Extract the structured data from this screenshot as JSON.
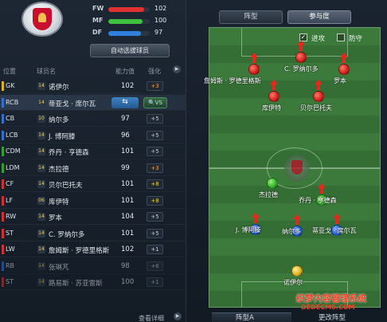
{
  "team": {
    "crest": "liverpool-crest-icon"
  },
  "stats": [
    {
      "label": "FW",
      "value": "102",
      "pct": 0.86,
      "color": "#e03030"
    },
    {
      "label": "MF",
      "value": "100",
      "pct": 0.82,
      "color": "#40c040"
    },
    {
      "label": "DF",
      "value": "97",
      "pct": 0.78,
      "color": "#3080e0"
    }
  ],
  "auto_button": "自动选拔球员",
  "table": {
    "headers": {
      "pos": "位置",
      "name": "球员名",
      "rating": "能力值",
      "strengthen": "强化"
    },
    "rows": [
      {
        "pos": "GK",
        "stripe": "#e0b020",
        "kit": "14",
        "name": "诺伊尔",
        "rating": "102",
        "chip": "+3",
        "chip_color": "#f0a040"
      },
      {
        "pos": "RCB",
        "stripe": "#3070d0",
        "kit": "14",
        "name": "蒂亚戈 · 席尔瓦",
        "rating": "",
        "chip": "",
        "chip_color": "#ffffff"
      },
      {
        "pos": "CB",
        "stripe": "#3070d0",
        "kit": "10",
        "name": "纳尔多",
        "rating": "97",
        "chip": "+5",
        "chip_color": "#c0c8d0"
      },
      {
        "pos": "LCB",
        "stripe": "#3070d0",
        "kit": "14",
        "name": "J. 博阿滕",
        "rating": "96",
        "chip": "+5",
        "chip_color": "#c0c8d0"
      },
      {
        "pos": "CDM",
        "stripe": "#30a030",
        "kit": "14",
        "name": "乔丹 · 亨德森",
        "rating": "101",
        "chip": "+5",
        "chip_color": "#c0c8d0"
      },
      {
        "pos": "LDM",
        "stripe": "#30a030",
        "kit": "14",
        "name": "杰拉德",
        "rating": "99",
        "chip": "+3",
        "chip_color": "#f0a040"
      },
      {
        "pos": "CF",
        "stripe": "#d03030",
        "kit": "14",
        "name": "贝尔巴托夫",
        "rating": "101",
        "chip": "+8",
        "chip_color": "#f0d040"
      },
      {
        "pos": "LF",
        "stripe": "#d03030",
        "kit": "06",
        "name": "库伊特",
        "rating": "101",
        "chip": "+8",
        "chip_color": "#f0d040"
      },
      {
        "pos": "RW",
        "stripe": "#d03030",
        "kit": "14",
        "name": "罗本",
        "rating": "104",
        "chip": "+5",
        "chip_color": "#c0c8d0"
      },
      {
        "pos": "ST",
        "stripe": "#d03030",
        "kit": "14",
        "name": "C. 罗纳尔多",
        "rating": "101",
        "chip": "+5",
        "chip_color": "#c0c8d0"
      },
      {
        "pos": "LW",
        "stripe": "#d03030",
        "kit": "14",
        "name": "詹姆斯 · 罗德里格斯",
        "rating": "102",
        "chip": "+1",
        "chip_color": "#c0c8d0"
      },
      {
        "pos": "RB",
        "stripe": "#3070d0",
        "kit": "14",
        "name": "张琳芃",
        "rating": "98",
        "chip": "+6",
        "chip_color": "#c0c8d0"
      },
      {
        "pos": "ST",
        "stripe": "#d03030",
        "kit": "14",
        "name": "路易斯 · 苏亚雷斯",
        "rating": "100",
        "chip": "+1",
        "chip_color": "#c0c8d0"
      }
    ]
  },
  "swap_label": "⇆",
  "vs_label": "VS",
  "detail_link": "查看详细",
  "tabs": {
    "formation": "阵型",
    "participation": "参与度"
  },
  "toggles": {
    "attack": "进攻",
    "defense": "防守"
  },
  "pitch_players": [
    {
      "name": "C. 罗纳尔多",
      "color": "red",
      "arrow": true
    },
    {
      "name": "詹姆斯 · 罗德里格斯",
      "color": "red",
      "arrow": true
    },
    {
      "name": "罗本",
      "color": "red",
      "arrow": true
    },
    {
      "name": "库伊特",
      "color": "red",
      "arrow": true
    },
    {
      "name": "贝尔巴托夫",
      "color": "red",
      "arrow": true
    },
    {
      "name": "杰拉德",
      "color": "green",
      "arrow": false
    },
    {
      "name": "乔丹 · 亨德森",
      "color": "green",
      "arrow": true
    },
    {
      "name": "J. 博阿滕",
      "color": "blue",
      "arrow": true
    },
    {
      "name": "纳尔多",
      "color": "blue",
      "arrow": true
    },
    {
      "name": "蒂亚戈 · 席尔瓦",
      "color": "blue",
      "arrow": true
    },
    {
      "name": "诺伊尔",
      "color": "gold",
      "arrow": false
    }
  ],
  "footer": {
    "formation": "阵型A",
    "change": "更改阵型"
  },
  "watermark": {
    "text": "织梦内容管理系统",
    "url": "DEDECMS.COM"
  }
}
